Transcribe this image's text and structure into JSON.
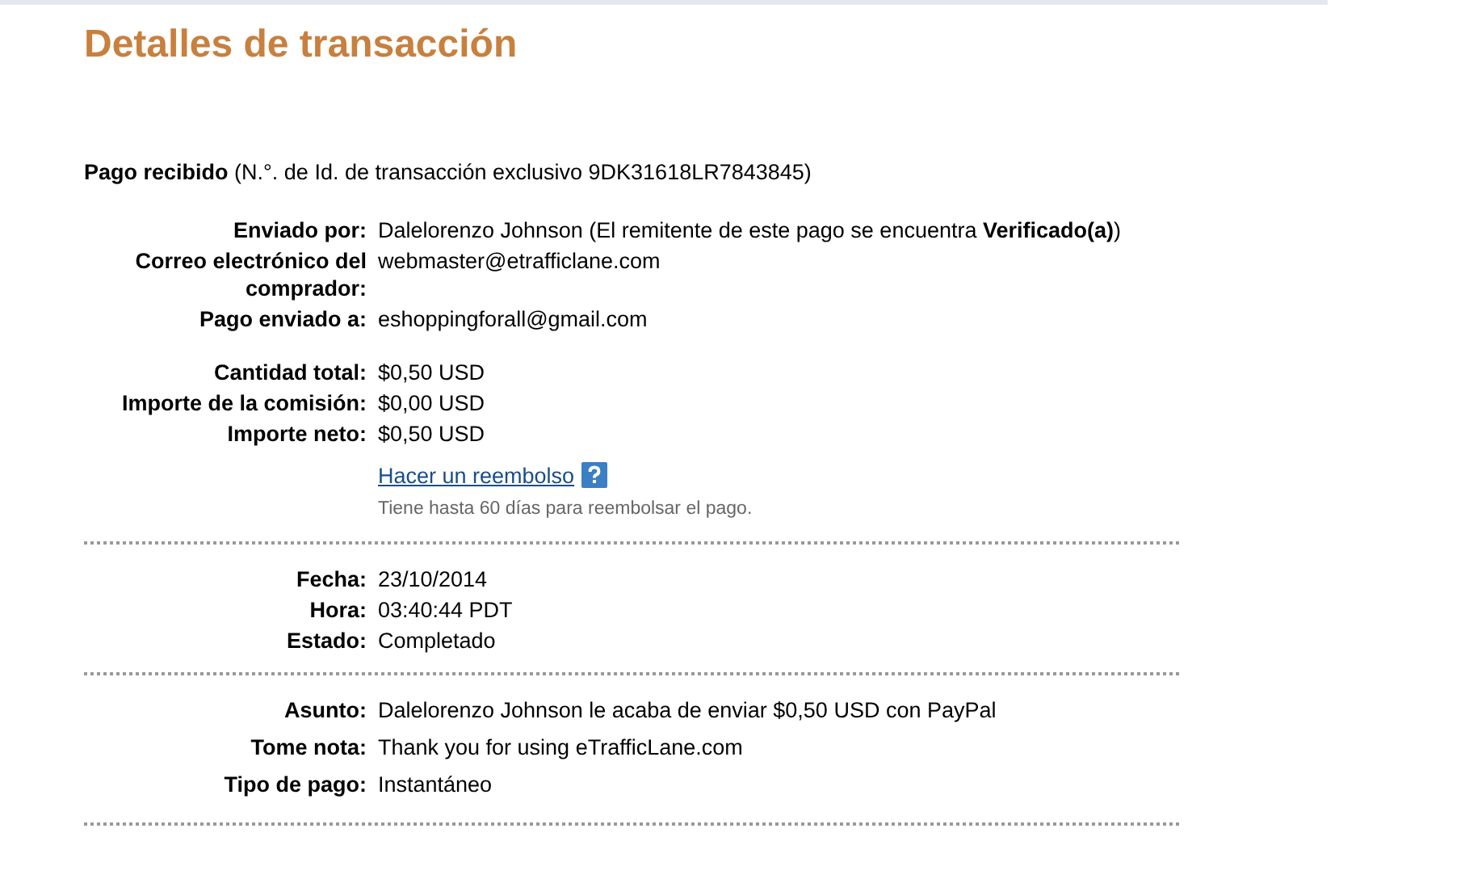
{
  "title": "Detalles de transacción",
  "header": {
    "label": "Pago recibido",
    "text": "(N.°. de Id. de transacción exclusivo 9DK31618LR7843845)"
  },
  "sections": [
    {
      "groups": [
        [
          {
            "kind": "field",
            "label": "Enviado por:",
            "value": "Dalelorenzo Johnson (El remitente de este pago se encuentra **Verificado(a)**)"
          },
          {
            "kind": "field",
            "label": "Correo electrónico del comprador:",
            "value": "webmaster@etrafficlane.com"
          },
          {
            "kind": "field",
            "label": "Pago enviado a:",
            "value": "eshoppingforall@gmail.com"
          }
        ],
        [
          {
            "kind": "field",
            "label": "Cantidad total:",
            "value": "$0,50 USD"
          },
          {
            "kind": "field",
            "label": "Importe de la comisión:",
            "value": "$0,00 USD"
          },
          {
            "kind": "field",
            "label": "Importe neto:",
            "value": "$0,50 USD"
          },
          {
            "kind": "link",
            "value": "Hacer un reembolso"
          },
          {
            "kind": "note",
            "value": "Tiene hasta 60 días para reembolsar el pago."
          }
        ]
      ]
    },
    {
      "groups": [
        [
          {
            "kind": "field",
            "label": "Fecha:",
            "value": "23/10/2014"
          },
          {
            "kind": "field",
            "label": "Hora:",
            "value": "03:40:44 PDT"
          },
          {
            "kind": "field",
            "label": "Estado:",
            "value": "Completado"
          }
        ]
      ]
    },
    {
      "groups": [
        [
          {
            "kind": "field",
            "label": "Asunto:",
            "value": "Dalelorenzo Johnson le acaba de enviar $0,50 USD con PayPal"
          },
          {
            "kind": "field",
            "label": "Tome nota:",
            "value": "Thank you for using eTrafficLane.com"
          },
          {
            "kind": "field",
            "label": "Tipo de pago:",
            "value": "Instantáneo"
          }
        ]
      ]
    }
  ]
}
